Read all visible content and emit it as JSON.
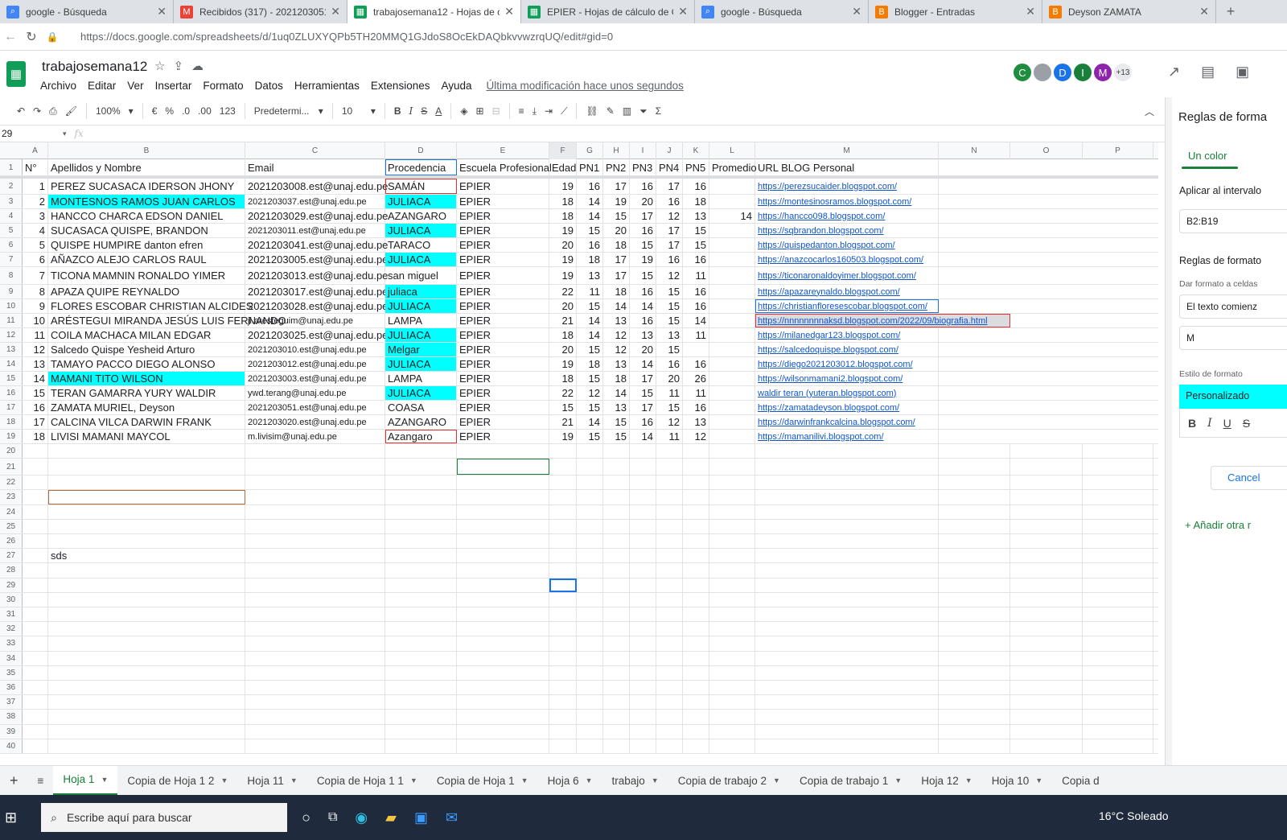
{
  "browser_tabs": [
    {
      "title": "google - Búsqueda",
      "icon": "google-icon"
    },
    {
      "title": "Recibidos (317) - 2021203051.est",
      "icon": "gmail-icon"
    },
    {
      "title": "trabajosemana12 - Hojas de cálc",
      "icon": "sheets-icon"
    },
    {
      "title": "EPIER - Hojas de cálculo de Goo",
      "icon": "sheets-icon"
    },
    {
      "title": "google - Búsqueda",
      "icon": "google-icon"
    },
    {
      "title": "Blogger - Entradas",
      "icon": "blogger-icon"
    },
    {
      "title": "Deyson ZAMATA",
      "icon": "blogger-icon"
    }
  ],
  "address_url": "https://docs.google.com/spreadsheets/d/1uq0ZLUXYQPb5TH20MMQ1GJdoS8OcEkDAQbkvvwzrqUQ/edit#gid=0",
  "doc_title": "trabajosemana12",
  "menu": [
    "Archivo",
    "Editar",
    "Ver",
    "Insertar",
    "Formato",
    "Datos",
    "Herramientas",
    "Extensiones",
    "Ayuda"
  ],
  "last_modified": "Última modificación hace unos segundos",
  "avatars": [
    {
      "l": "C",
      "c": "#1e8e3e"
    },
    {
      "l": "",
      "c": "#9aa0a6"
    },
    {
      "l": "D",
      "c": "#1a73e8"
    },
    {
      "l": "I",
      "c": "#188038"
    },
    {
      "l": "M",
      "c": "#8e24aa"
    }
  ],
  "avatar_more": "+13",
  "toolbar": {
    "zoom": "100%",
    "currency": "€",
    "percent": "%",
    "dec_less": ".0",
    "dec_more": ".00",
    "format_123": "123",
    "font": "Predetermi...",
    "font_size": "10"
  },
  "name_box": "29",
  "fx": "fx",
  "columns": [
    "A",
    "B",
    "C",
    "D",
    "E",
    "F",
    "G",
    "H",
    "I",
    "J",
    "K",
    "L",
    "M",
    "N",
    "O",
    "P"
  ],
  "header_row": [
    "N°",
    "Apellidos y Nombre",
    "Email",
    "Procedencia",
    "Escuela Profesional",
    "Edad",
    "PN1",
    "PN2",
    "PN3",
    "PN4",
    "PN5",
    "Promedio",
    "URL BLOG Personal"
  ],
  "students": [
    [
      "1",
      "PEREZ SUCASACA IDERSON JHONY",
      "2021203008.est@unaj.edu.pe",
      "SAMÁN",
      "EPIER",
      "19",
      "16",
      "17",
      "16",
      "17",
      "16",
      "",
      "https://perezsucaider.blogspot.com/"
    ],
    [
      "2",
      "MONTESNOS RAMOS JUAN CARLOS",
      "2021203037.est@unaj.edu.pe",
      "JULIACA",
      "EPIER",
      "18",
      "14",
      "19",
      "20",
      "16",
      "18",
      "",
      "https://montesinosramos.blogspot.com/"
    ],
    [
      "3",
      "HANCCO CHARCA EDSON DANIEL",
      "2021203029.est@unaj.edu.pe",
      "AZANGARO",
      "EPIER",
      "18",
      "14",
      "15",
      "17",
      "12",
      "13",
      "14",
      "https://hancco098.blogspot.com/"
    ],
    [
      "4",
      "SUCASACA QUISPE, BRANDON",
      "2021203011.est@unaj.edu.pe",
      "JULIACA",
      "EPIER",
      "19",
      "15",
      "20",
      "16",
      "17",
      "15",
      "",
      "https://sqbrandon.blogspot.com/"
    ],
    [
      "5",
      "QUISPE HUMPIRE danton efren",
      "2021203041.est@unaj.edu.pe",
      "TARACO",
      "EPIER",
      "20",
      "16",
      "18",
      "15",
      "17",
      "15",
      "",
      "https://quispedanton.blogspot.com/"
    ],
    [
      "6",
      "AÑAZCO ALEJO CARLOS RAUL",
      "2021203005.est@unaj.edu.pe",
      "JULIACA",
      "EPIER",
      "19",
      "18",
      "17",
      "19",
      "16",
      "16",
      "",
      "https://anazcocarlos160503.blogspot.com/"
    ],
    [
      "7",
      "TICONA MAMNIN RONALDO YIMER",
      "2021203013.est@unaj.edu.pe",
      "san miguel",
      "EPIER",
      "19",
      "13",
      "17",
      "15",
      "12",
      "11",
      "",
      "https://ticonaronaldoyimer.blogspot.com/"
    ],
    [
      "8",
      "APAZA QUIPE REYNALDO",
      "2021203017.est@unaj.edu.pe",
      "juliaca",
      "EPIER",
      "22",
      "11",
      "18",
      "16",
      "15",
      "16",
      "",
      "https://apazareynaldo.blogspot.com/"
    ],
    [
      "9",
      "FLORES ESCOBAR CHRISTIAN ALCIDES",
      "2021203028.est@unaj.edu.pe",
      "JULIACA",
      "EPIER",
      "20",
      "15",
      "14",
      "14",
      "15",
      "16",
      "",
      "https://christianfloresescobar.blogspot.com/"
    ],
    [
      "10",
      "ARÉSTEGUI MIRANDA JESÚS LUIS FERNANDO",
      "jl.aresteguim@unaj.edu.pe",
      "LAMPA",
      "EPIER",
      "21",
      "14",
      "13",
      "16",
      "15",
      "14",
      "",
      "https://nnnnnnnnaksd.blogspot.com/2022/09/biografia.html"
    ],
    [
      "11",
      "COILA MACHACA MILAN EDGAR",
      "2021203025.est@unaj.edu.pe",
      "JULIACA",
      "EPIER",
      "18",
      "14",
      "12",
      "13",
      "13",
      "11",
      "",
      "https://milanedgar123.blogspot.com/"
    ],
    [
      "12",
      "Salcedo Quispe Yesheid Arturo",
      "2021203010.est@unaj.edu.pe",
      "Melgar",
      "EPIER",
      "20",
      "15",
      "12",
      "20",
      "15",
      "",
      "",
      "https://salcedoquispe.blogspot.com/"
    ],
    [
      "13",
      "TAMAYO PACCO DIEGO ALONSO",
      "2021203012.est@unaj.edu.pe",
      "JULIACA",
      "EPIER",
      "19",
      "18",
      "13",
      "14",
      "16",
      "16",
      "",
      "https://diego2021203012.blogspot.com/"
    ],
    [
      "14",
      "MAMANI TITO WILSON",
      "2021203003.est@unaj.edu.pe",
      "LAMPA",
      "EPIER",
      "18",
      "15",
      "18",
      "17",
      "20",
      "26",
      "",
      "https://wilsonmamani2.blogspot.com/"
    ],
    [
      "15",
      "TERAN GAMARRA YURY WALDIR",
      "ywd.terang@unaj.edu.pe",
      "JULIACA",
      "EPIER",
      "22",
      "12",
      "14",
      "15",
      "11",
      "11",
      "",
      "waldir teran (yuteran.blogspot.com)"
    ],
    [
      "16",
      "ZAMATA MURIEL, Deyson",
      "2021203051.est@unaj.edu.pe",
      "COASA",
      "EPIER",
      "15",
      "15",
      "13",
      "17",
      "15",
      "16",
      "",
      "https://zamatadeyson.blogspot.com/"
    ],
    [
      "17",
      "CALCINA VILCA DARWIN FRANK",
      "2021203020.est@unaj.edu.pe",
      "AZANGARO",
      "EPIER",
      "21",
      "14",
      "15",
      "16",
      "12",
      "13",
      "",
      "https://darwinfrankcalcina.blogspot.com/"
    ],
    [
      "18",
      "LIVISI MAMANI MAYCOL",
      "m.livisim@unaj.edu.pe",
      "Azangaro",
      "EPIER",
      "19",
      "15",
      "15",
      "14",
      "11",
      "12",
      "",
      "https://mamanilivi.blogspot.com/"
    ]
  ],
  "cell_B27": "sds",
  "panel": {
    "title": "Reglas de forma",
    "tab": "Un color",
    "apply_label": "Aplicar al intervalo",
    "range": "B2:B19",
    "rules_label": "Reglas de formato",
    "condition_label": "Dar formato a celdas",
    "condition": "El texto comienz",
    "value": "M",
    "style_label": "Estilo de formato",
    "style_preset": "Personalizado",
    "cancel": "Cancel",
    "add_rule": "+  Añadir otra r"
  },
  "sheet_tabs": [
    "Hoja 1",
    "Copia de Hoja 1 2",
    "Hoja 11",
    "Copia de Hoja 1 1",
    "Copia de Hoja 1",
    "Hoja 6",
    "trabajo",
    "Copia de trabajo 2",
    "Copia de trabajo 1",
    "Hoja 12",
    "Hoja 10",
    "Copia d"
  ],
  "taskbar": {
    "search_placeholder": "Escribe aquí para buscar",
    "weather": "16°C  Soleado"
  },
  "colors": {
    "cyan_fill": "#00ffff",
    "sheets_green": "#188038",
    "link": "#1155cc"
  }
}
